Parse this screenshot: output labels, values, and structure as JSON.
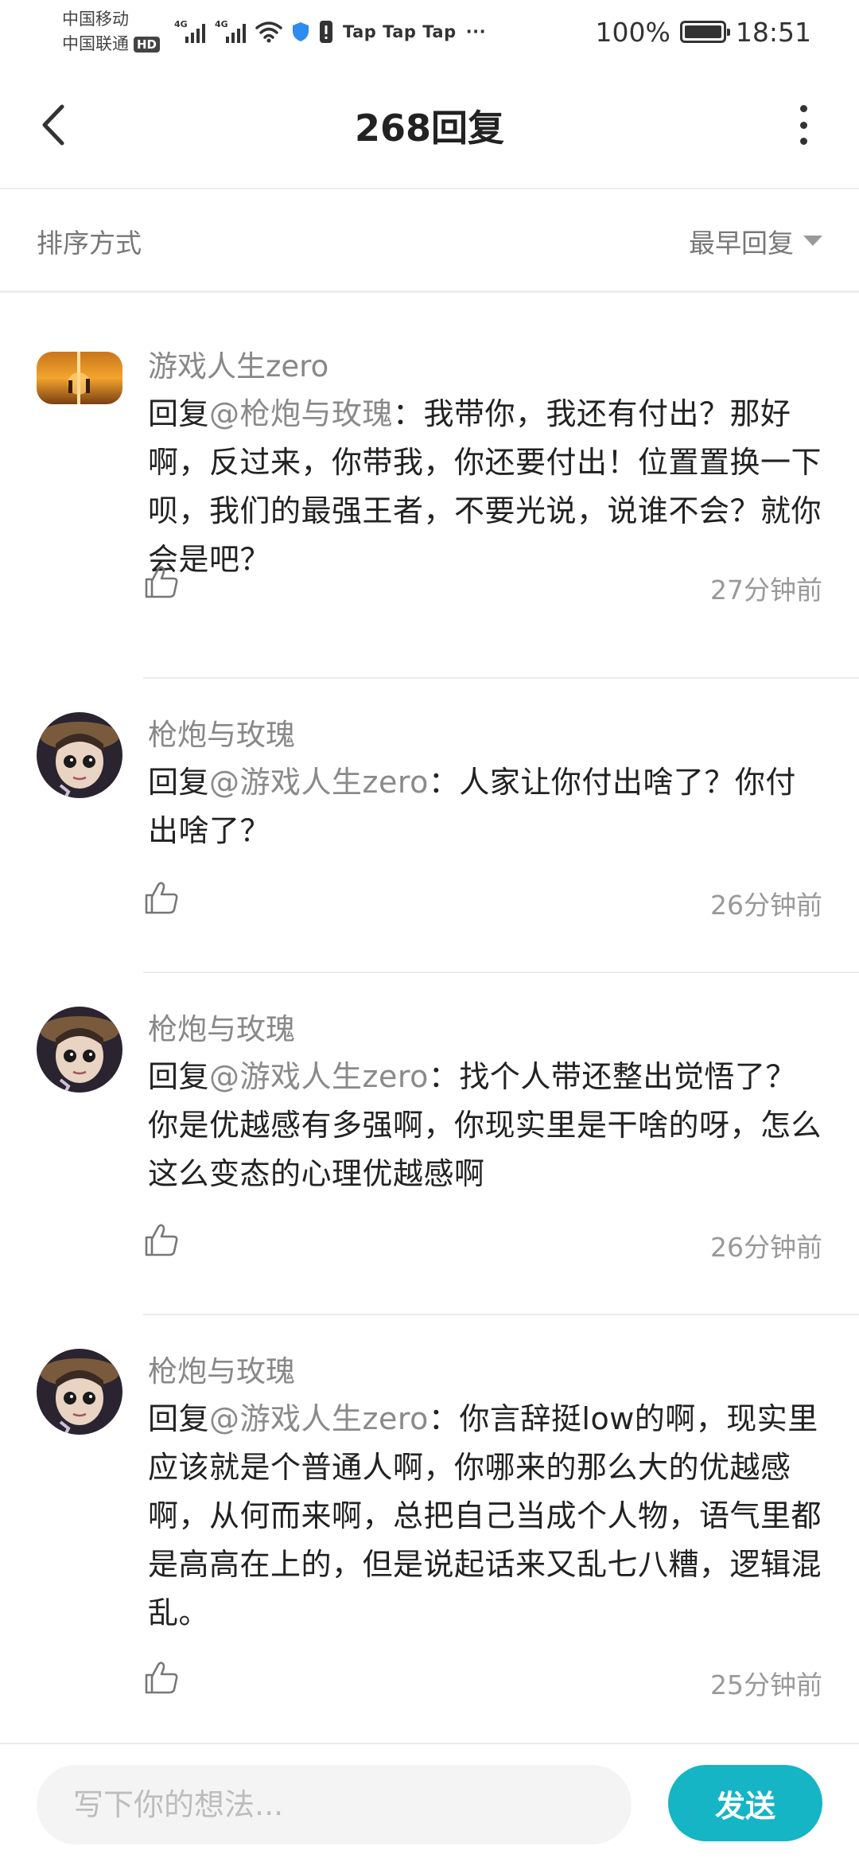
{
  "status_bar": {
    "carrier_1": "中国移动",
    "carrier_2": "中国联通",
    "hd_badge": "HD",
    "signal_label_1": "4G",
    "signal_label_2": "4G",
    "tap_apps": "Tap Tap Tap",
    "overflow": "···",
    "battery_percent": "100%",
    "time": "18:51",
    "icons": [
      "signal-icon",
      "wifi-icon",
      "shield-icon",
      "alert-icon",
      "battery-icon"
    ]
  },
  "header": {
    "title": "268回复",
    "back_icon": "chevron-left-icon",
    "more_icon": "more-vertical-icon"
  },
  "sort": {
    "label": "排序方式",
    "selected": "最早回复"
  },
  "comments": [
    {
      "user": "游戏人生zero",
      "prefix": "回复",
      "mention": "@枪炮与玫瑰",
      "text": "：我带你，我还有付出？那好啊，反过来，你带我，你还要付出！位置置换一下呗，我们的最强王者，不要光说，说谁不会？就你会是吧？",
      "time": "27分钟前"
    },
    {
      "user": "枪炮与玫瑰",
      "prefix": "回复",
      "mention": "@游戏人生zero",
      "text": "：人家让你付出啥了？你付出啥了？",
      "time": "26分钟前"
    },
    {
      "user": "枪炮与玫瑰",
      "prefix": "回复",
      "mention": "@游戏人生zero",
      "text": "：找个人带还整出觉悟了？你是优越感有多强啊，你现实里是干啥的呀，怎么这么变态的心理优越感啊",
      "time": "26分钟前"
    },
    {
      "user": "枪炮与玫瑰",
      "prefix": "回复",
      "mention": "@游戏人生zero",
      "text": "：你言辞挺low的啊，现实里应该就是个普通人啊，你哪来的那么大的优越感啊，从何而来啊，总把自己当成个人物，语气里都是高高在上的，但是说起话来又乱七八糟，逻辑混乱。",
      "time": "25分钟前"
    }
  ],
  "composer": {
    "placeholder": "写下你的想法...",
    "send_label": "发送"
  },
  "colors": {
    "accent": "#15b5c5",
    "mention": "#8a8a8a",
    "muted": "#999999"
  }
}
